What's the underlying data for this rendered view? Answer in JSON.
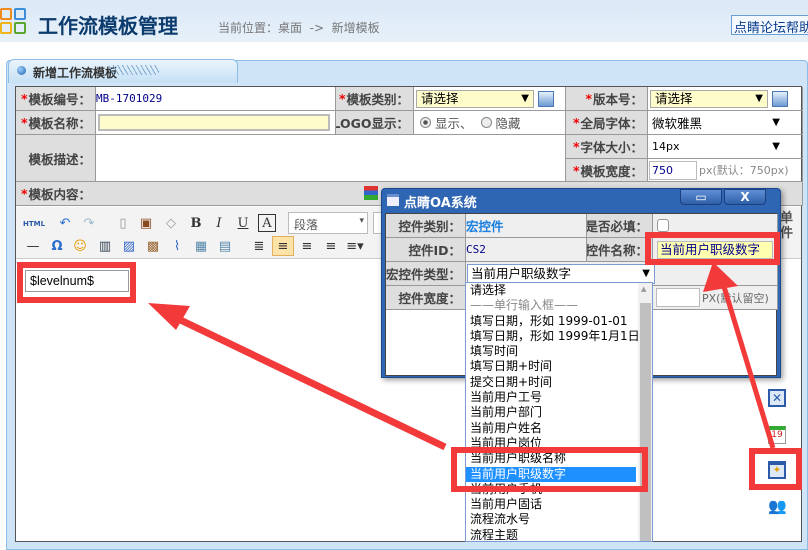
{
  "header": {
    "title": "工作流模板管理",
    "breadcrumb": "当前位置：桌面  ->  新增模板",
    "help_button": "点睛论坛帮助"
  },
  "panel": {
    "tab_label": "新增工作流模板"
  },
  "form": {
    "template_no_label": "模板编号：",
    "template_no": "MB-1701029",
    "category_label": "模板类别：",
    "category_value": "请选择",
    "version_label": "版本号：",
    "version_value": "请选择",
    "name_label": "模板名称：",
    "name_value": "",
    "logo_label": "LOGO显示：",
    "logo_show": "显示、",
    "logo_hide": "隐藏",
    "font_label": "全局字体：",
    "font_value": "微软雅黑",
    "desc_label": "模板描述：",
    "size_label": "字体大小：",
    "size_value": "14px",
    "width_label": "模板宽度：",
    "width_value": "750",
    "width_hint": "px(默认：750px)",
    "content_label": "模板内容："
  },
  "editor": {
    "html_btn": "HTML",
    "paragraph": "段落",
    "field_value": "$levelnum$",
    "side_label": "单件"
  },
  "dialog": {
    "title": "点睛OA系统",
    "type_label": "控件类别：",
    "type_value": "宏控件",
    "required_label": "是否必填：",
    "id_label": "控件ID：",
    "id_value": "CS2",
    "name_label": "控件名称：",
    "name_value": "当前用户职级数字",
    "macro_label": "宏控件类型：",
    "macro_value": "当前用户职级数字",
    "width_label": "控件宽度：",
    "width_hint": "PX(默认留空)",
    "max_btn": "▭",
    "close_btn": "X"
  },
  "dropdown": {
    "options": [
      "请选择",
      "——单行输入框——",
      "填写日期，形如 1999-01-01",
      "填写日期，形如 1999年1月1日",
      "填写时间",
      "填写日期+时间",
      "提交日期+时间",
      "当前用户工号",
      "当前用户部门",
      "当前用户姓名",
      "当前用户岗位",
      "当前用户职级名称",
      "当前用户职级数字",
      "当前用户手机",
      "当前用户固话",
      "流程流水号",
      "流程主题"
    ],
    "selected": "当前用户职级数字"
  },
  "colors": {
    "highlight": "#f23a3a",
    "selected": "#1e90ff",
    "dialog": "#2f66b3"
  }
}
